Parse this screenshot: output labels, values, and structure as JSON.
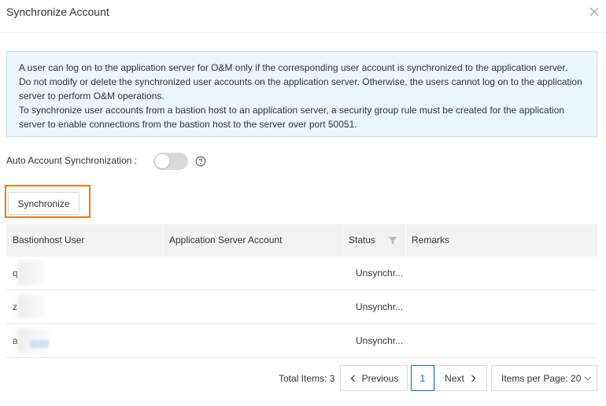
{
  "dialog": {
    "title": "Synchronize Account"
  },
  "notice": {
    "lines": [
      "A user can log on to the application server for O&M only if the corresponding user account is synchronized to the application server.",
      "Do not modify or delete the synchronized user accounts on the application server. Otherwise, the users cannot log on to the application",
      "server to perform O&M operations.",
      "To synchronize user accounts from a bastion host to an application server, a security group rule must be created for the application",
      "server to enable connections from the bastion host to the server over port 50051."
    ],
    "background_color": "#ebf6fd",
    "border_color": "#b9dff6"
  },
  "auto_sync": {
    "label": "Auto Account Synchronization :",
    "enabled": false
  },
  "toolbar": {
    "synchronize_label": "Synchronize",
    "highlight_color": "#f07a19"
  },
  "table": {
    "columns": [
      "Bastionhost User",
      "Application Server Account",
      "Status",
      "Remarks"
    ],
    "rows": [
      {
        "user": "q",
        "server_account": "",
        "status": "Unsynchr...",
        "remarks": ""
      },
      {
        "user": "z",
        "server_account": "",
        "status": "Unsynchr...",
        "remarks": ""
      },
      {
        "user": "a",
        "server_account": "",
        "status": "Unsynchr...",
        "remarks": ""
      }
    ]
  },
  "pagination": {
    "total_label": "Total Items: 3",
    "previous_label": "Previous",
    "next_label": "Next",
    "current_page": "1",
    "page_size_label": "Items per Page: 20",
    "accent_color": "#0070cc"
  }
}
